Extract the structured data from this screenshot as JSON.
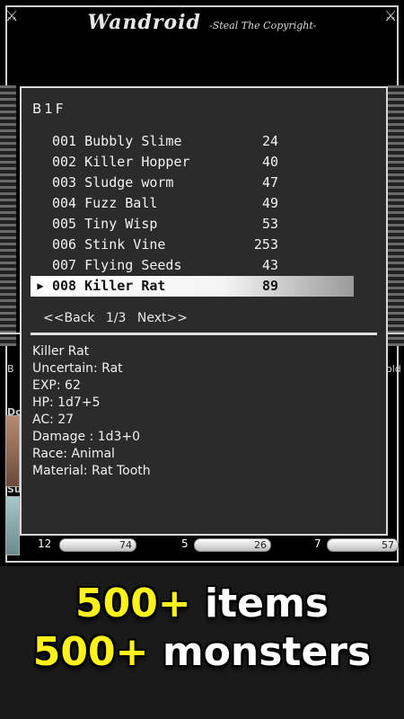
{
  "header": {
    "title": "Wandroid",
    "subtitle": "-Steal The Copyright-"
  },
  "background": {
    "left_labels": [
      "B",
      "Do",
      "Su"
    ],
    "right_labels": [
      "old"
    ],
    "status": [
      {
        "left": "12",
        "bar": "74"
      },
      {
        "left": "5",
        "bar": "26"
      },
      {
        "left": "7",
        "bar": "57"
      }
    ]
  },
  "modal": {
    "floor": "B1F",
    "monsters": [
      {
        "label": "001 Bubbly Slime",
        "value": "24"
      },
      {
        "label": "002 Killer Hopper",
        "value": "40"
      },
      {
        "label": "003 Sludge worm",
        "value": "47"
      },
      {
        "label": "004 Fuzz Ball",
        "value": "49"
      },
      {
        "label": "005 Tiny Wisp",
        "value": "53"
      },
      {
        "label": "006 Stink Vine",
        "value": "253"
      },
      {
        "label": "007 Flying Seeds",
        "value": "43"
      },
      {
        "label": "008 Killer Rat",
        "value": "89"
      }
    ],
    "selected_index": 7,
    "pager": {
      "back": "<<Back",
      "page": "1/3",
      "next": "Next>>"
    },
    "detail": [
      "Killer Rat",
      "Uncertain: Rat",
      "EXP: 62",
      "HP: 1d7+5",
      "AC: 27",
      "Damage : 1d3+0",
      "Race: Animal",
      "Material: Rat Tooth"
    ]
  },
  "promo": {
    "line1_num": "500+",
    "line1_text": "items",
    "line2_num": "500+",
    "line2_text": "monsters"
  },
  "colors": {
    "promo_number": "#fff21a",
    "panel": "#2b2b2b",
    "selected_row": "#ffffff"
  },
  "icons": {
    "corner": "crossed-swords-icon",
    "pointer": "triangle-right-icon",
    "skull": "skull-icon"
  }
}
